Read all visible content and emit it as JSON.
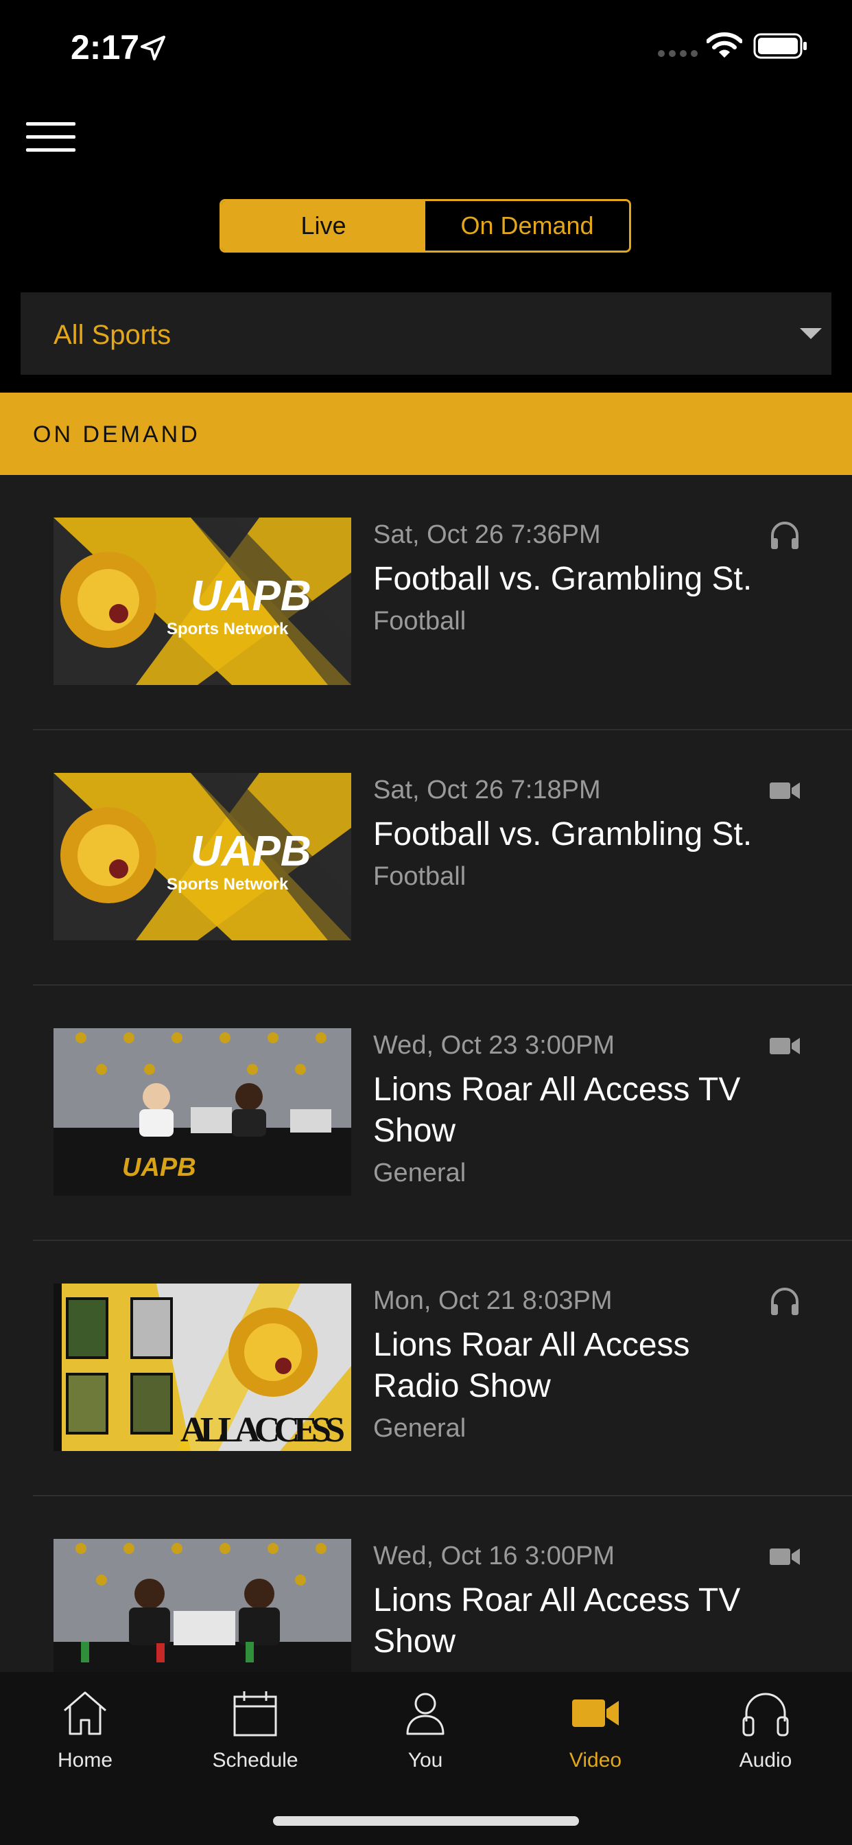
{
  "status": {
    "time": "2:17"
  },
  "toggle": {
    "live_label": "Live",
    "ondemand_label": "On Demand"
  },
  "filter": {
    "selected": "All Sports"
  },
  "section": {
    "title": "ON DEMAND"
  },
  "items": [
    {
      "date": "Sat, Oct 26 7:36PM",
      "title": "Football vs. Grambling St.",
      "category": "Football",
      "media": "headphones-icon",
      "thumb": "uapb-sports-network"
    },
    {
      "date": "Sat, Oct 26 7:18PM",
      "title": "Football vs. Grambling St.",
      "category": "Football",
      "media": "video-camera-icon",
      "thumb": "uapb-sports-network"
    },
    {
      "date": "Wed, Oct 23 3:00PM",
      "title": "Lions Roar All Access TV Show",
      "category": "General",
      "media": "video-camera-icon",
      "thumb": "studio-desk"
    },
    {
      "date": "Mon, Oct 21 8:03PM",
      "title": "Lions Roar All Access Radio Show",
      "category": "General",
      "media": "headphones-icon",
      "thumb": "all-access"
    },
    {
      "date": "Wed, Oct 16 3:00PM",
      "title": "Lions Roar All Access TV Show",
      "category": "",
      "media": "video-camera-icon",
      "thumb": "studio-desk"
    }
  ],
  "tabs": [
    {
      "label": "Home",
      "icon": "home-icon"
    },
    {
      "label": "Schedule",
      "icon": "calendar-icon"
    },
    {
      "label": "You",
      "icon": "person-icon"
    },
    {
      "label": "Video",
      "icon": "video-camera-icon",
      "active": true
    },
    {
      "label": "Audio",
      "icon": "headphones-icon"
    }
  ],
  "colors": {
    "accent": "#e3a71b",
    "background": "#000000",
    "list_bg": "#1c1c1c",
    "muted_text": "#9a9a9a"
  },
  "thumb_text": {
    "brand": "UAPB",
    "sub": "Sports Network",
    "all_access": "ALL ACCESS"
  }
}
